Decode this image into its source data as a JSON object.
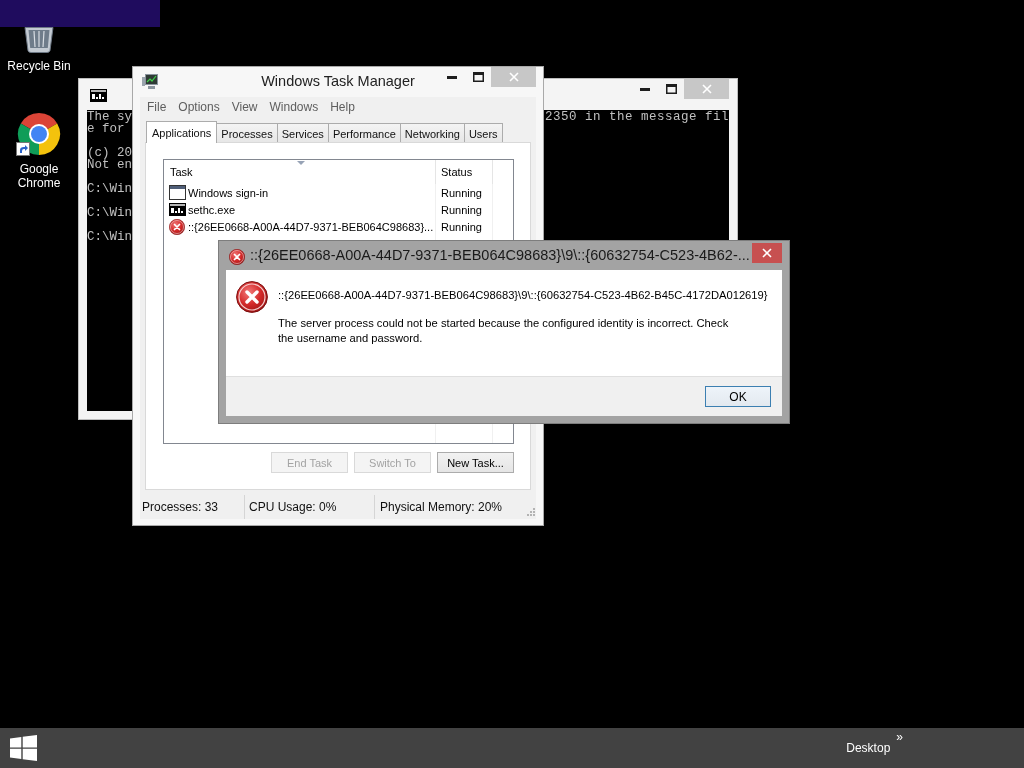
{
  "desktop_icons": [
    {
      "kind": "recycle-bin",
      "label": "Recycle Bin",
      "shortcut": false
    },
    {
      "kind": "browser",
      "label": "Google Chrome",
      "shortcut": true
    }
  ],
  "console_window": {
    "blocks": [
      {
        "lines": [
          {
            "text": "The sy",
            "right_text": "2350 in the message fil"
          },
          {
            "text": "e for"
          }
        ]
      },
      {
        "lines": [
          {
            "text": "(c) 20"
          },
          {
            "text": "Not en"
          }
        ]
      },
      {
        "lines": [
          {
            "text": "C:\\Win"
          }
        ]
      },
      {
        "lines": [
          {
            "text": "C:\\Win"
          }
        ]
      },
      {
        "lines": [
          {
            "text": "C:\\Win"
          }
        ]
      }
    ]
  },
  "task_manager": {
    "title": "Windows Task Manager",
    "menu": [
      "File",
      "Options",
      "View",
      "Windows",
      "Help"
    ],
    "tabs": [
      {
        "label": "Applications",
        "selected": true
      },
      {
        "label": "Processes",
        "selected": false
      },
      {
        "label": "Services",
        "selected": false
      },
      {
        "label": "Performance",
        "selected": false
      },
      {
        "label": "Networking",
        "selected": false
      },
      {
        "label": "Users",
        "selected": false
      }
    ],
    "columns": [
      "Task",
      "Status"
    ],
    "rows": [
      {
        "kind": "window",
        "task": "Windows sign-in",
        "status": "Running"
      },
      {
        "kind": "console",
        "task": "sethc.exe",
        "status": "Running"
      },
      {
        "kind": "error",
        "task": "::{26EE0668-A00A-44D7-9371-BEB064C98683}...",
        "status": "Running"
      }
    ],
    "buttons": [
      {
        "label": "End Task",
        "disabled": true
      },
      {
        "label": "Switch To",
        "disabled": true
      },
      {
        "label": "New Task...",
        "disabled": false
      }
    ],
    "status_bar": [
      "Processes: 33",
      "CPU Usage: 0%",
      "Physical Memory: 20%"
    ]
  },
  "error_dialog": {
    "title": "::{26EE0668-A00A-44D7-9371-BEB064C98683}\\9\\::{60632754-C523-4B62-...",
    "heading": "::{26EE0668-A00A-44D7-9371-BEB064C98683}\\9\\::{60632754-C523-4B62-B45C-4172DA012619}",
    "message": "The server process could not be started because the configured identity is incorrect. Check the username and password.",
    "buttons": [
      {
        "label": "OK",
        "default": true
      }
    ]
  },
  "taskbar": {
    "toolbar_label": "Desktop",
    "chevron": "»"
  }
}
